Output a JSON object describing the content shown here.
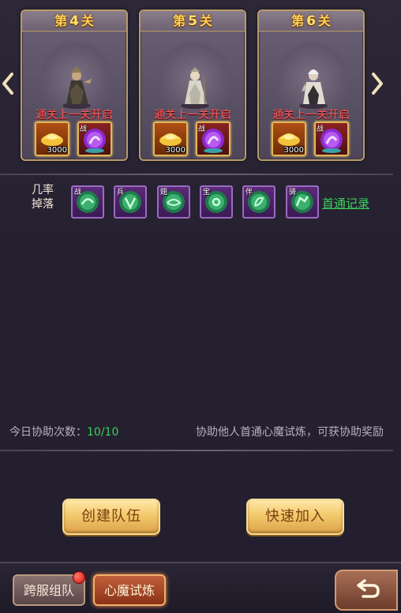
{
  "stages": [
    {
      "prefix": "第",
      "num": "4",
      "suffix": "关",
      "status": "通关上一关开启",
      "reward_gold_qty": "3000",
      "reward_orb_tag": "战"
    },
    {
      "prefix": "第",
      "num": "5",
      "suffix": "关",
      "status": "通关上一关开启",
      "reward_gold_qty": "3000",
      "reward_orb_tag": "战"
    },
    {
      "prefix": "第",
      "num": "6",
      "suffix": "关",
      "status": "通关上一关开启",
      "reward_gold_qty": "3000",
      "reward_orb_tag": "战"
    }
  ],
  "drops": {
    "label_line1": "几率",
    "label_line2": "掉落",
    "items": [
      {
        "tag": "战",
        "icon": "green-orb-icon"
      },
      {
        "tag": "兵",
        "icon": "green-orb-icon"
      },
      {
        "tag": "翅",
        "icon": "green-orb-icon"
      },
      {
        "tag": "宝",
        "icon": "green-orb-icon"
      },
      {
        "tag": "伴",
        "icon": "green-orb-icon"
      },
      {
        "tag": "骑",
        "icon": "green-orb-icon"
      }
    ],
    "first_clear_link": "首通记录"
  },
  "assist": {
    "count_label": "今日协助次数：",
    "count_value": "10/10",
    "tip": "协助他人首通心魔试炼，可获协助奖励"
  },
  "buttons": {
    "create_team": "创建队伍",
    "quick_join": "快速加入"
  },
  "bottom_tabs": {
    "cross_server": "跨服组队",
    "heart_demon": "心魔试炼"
  },
  "colors": {
    "accent_gold": "#ffd25a",
    "locked_red": "#ff5a5a",
    "link_green": "#3cd25c"
  }
}
